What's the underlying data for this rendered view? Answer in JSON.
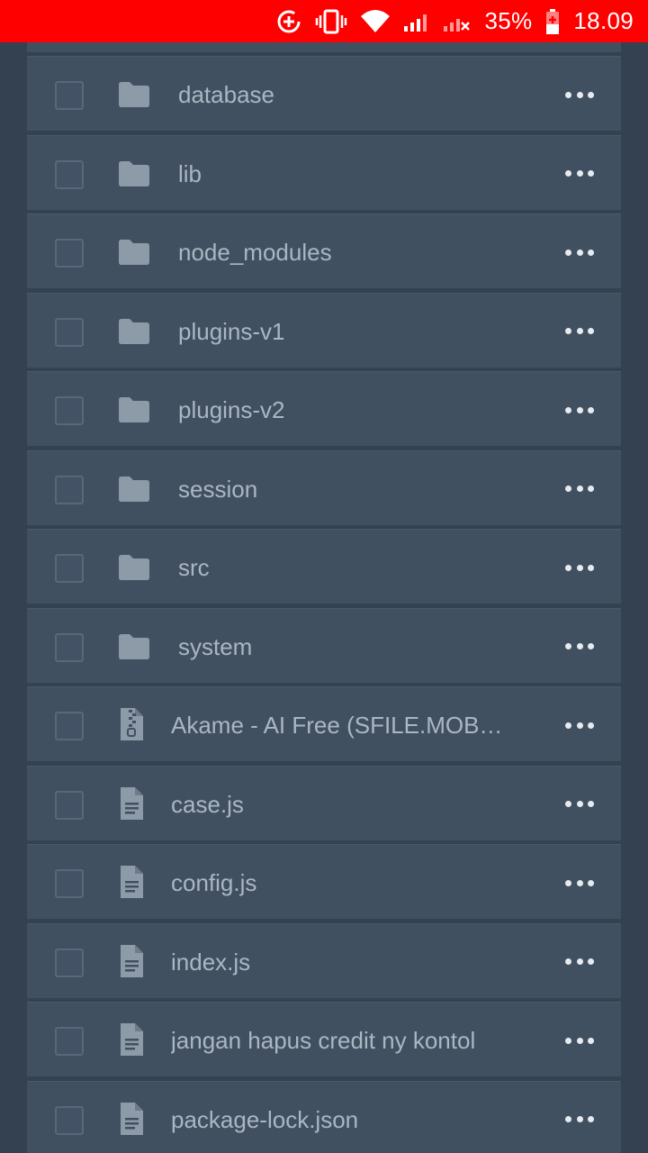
{
  "status_bar": {
    "battery": "35%",
    "time": "18.09",
    "icons": [
      "data-saver-icon",
      "vibrate-icon",
      "wifi-icon",
      "signal-icon",
      "no-signal-icon",
      "battery-charging-icon"
    ],
    "background": "#ff0000"
  },
  "files": [
    {
      "name": "database",
      "type": "folder",
      "icon": "folder-icon"
    },
    {
      "name": "lib",
      "type": "folder",
      "icon": "folder-icon"
    },
    {
      "name": "node_modules",
      "type": "folder",
      "icon": "folder-icon"
    },
    {
      "name": "plugins-v1",
      "type": "folder",
      "icon": "folder-icon"
    },
    {
      "name": "plugins-v2",
      "type": "folder",
      "icon": "folder-icon"
    },
    {
      "name": "session",
      "type": "folder",
      "icon": "folder-icon"
    },
    {
      "name": "src",
      "type": "folder",
      "icon": "folder-icon"
    },
    {
      "name": "system",
      "type": "folder",
      "icon": "folder-icon"
    },
    {
      "name": "Akame - AI Free (SFILE.MOB…",
      "type": "zip",
      "icon": "zip-file-icon"
    },
    {
      "name": "case.js",
      "type": "file",
      "icon": "file-icon"
    },
    {
      "name": "config.js",
      "type": "file",
      "icon": "file-icon"
    },
    {
      "name": "index.js",
      "type": "file",
      "icon": "file-icon"
    },
    {
      "name": "jangan hapus credit ny kontol",
      "type": "file",
      "icon": "file-icon"
    },
    {
      "name": "package-lock.json",
      "type": "file",
      "icon": "file-icon"
    }
  ],
  "colors": {
    "background": "#334150",
    "row": "#415061",
    "text": "#aab6c2",
    "icon": "#8d9aa8"
  }
}
